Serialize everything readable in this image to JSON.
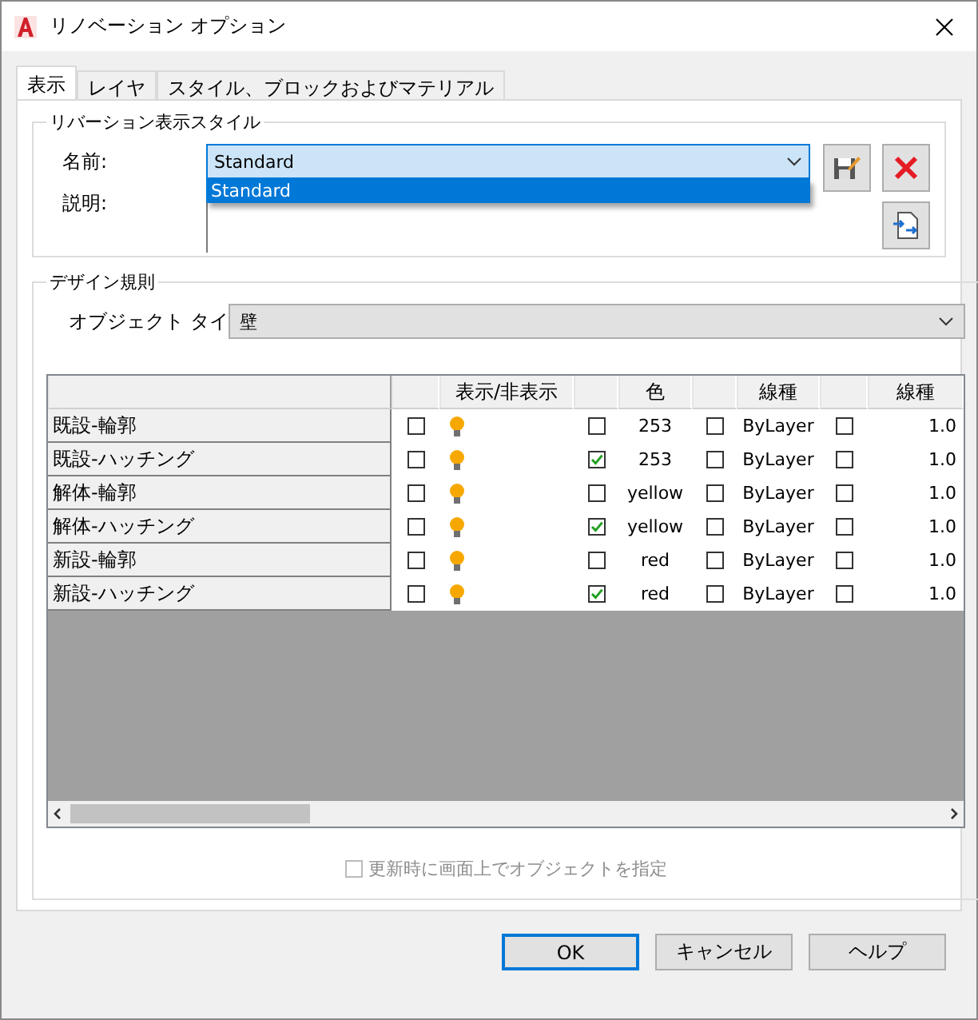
{
  "window": {
    "title": "リノベーション オプション"
  },
  "tabs": [
    {
      "label": "表示",
      "selected": true
    },
    {
      "label": "レイヤ",
      "selected": false
    },
    {
      "label": "スタイル、ブロックおよびマテリアル",
      "selected": false
    }
  ],
  "style_group": {
    "title": "リバーション表示スタイル",
    "name_label": "名前:",
    "name_value": "Standard",
    "dropdown_options": [
      {
        "label": "Standard",
        "selected": true
      }
    ],
    "description_label": "説明:"
  },
  "design_group": {
    "title": "デザイン規則",
    "object_type_label": "オブジェクト タイ",
    "object_type_value": "壁",
    "table": {
      "columns": [
        {
          "kind": "check"
        },
        {
          "kind": "text",
          "label": "表示/非表示"
        },
        {
          "kind": "check"
        },
        {
          "kind": "text",
          "label": "色"
        },
        {
          "kind": "check"
        },
        {
          "kind": "text",
          "label": "線種"
        },
        {
          "kind": "check"
        },
        {
          "kind": "text",
          "label": "線種"
        }
      ],
      "rows": [
        {
          "name": "既設-輪郭",
          "visible_override": false,
          "visible": true,
          "color_override": false,
          "color_name": "253",
          "linetype_override": false,
          "linetype": "ByLayer",
          "scale_override": false,
          "scale": "1.0"
        },
        {
          "name": "既設-ハッチング",
          "visible_override": false,
          "visible": true,
          "color_override": true,
          "color_name": "253",
          "linetype_override": false,
          "linetype": "ByLayer",
          "scale_override": false,
          "scale": "1.0"
        },
        {
          "name": "解体-輪郭",
          "visible_override": false,
          "visible": true,
          "color_override": false,
          "color_name": "yellow",
          "linetype_override": false,
          "linetype": "ByLayer",
          "scale_override": false,
          "scale": "1.0"
        },
        {
          "name": "解体-ハッチング",
          "visible_override": false,
          "visible": true,
          "color_override": true,
          "color_name": "yellow",
          "linetype_override": false,
          "linetype": "ByLayer",
          "scale_override": false,
          "scale": "1.0"
        },
        {
          "name": "新設-輪郭",
          "visible_override": false,
          "visible": true,
          "color_override": false,
          "color_name": "red",
          "linetype_override": false,
          "linetype": "ByLayer",
          "scale_override": false,
          "scale": "1.0"
        },
        {
          "name": "新設-ハッチング",
          "visible_override": false,
          "visible": true,
          "color_override": true,
          "color_name": "red",
          "linetype_override": false,
          "linetype": "ByLayer",
          "scale_override": false,
          "scale": "1.0"
        }
      ]
    },
    "pick_option": {
      "label": "更新時に画面上でオブジェクトを指定",
      "checked": false,
      "disabled": true
    }
  },
  "buttons": [
    {
      "label": "OK",
      "default": true
    },
    {
      "label": "キャンセル",
      "default": false
    },
    {
      "label": "ヘルプ",
      "default": false
    }
  ]
}
